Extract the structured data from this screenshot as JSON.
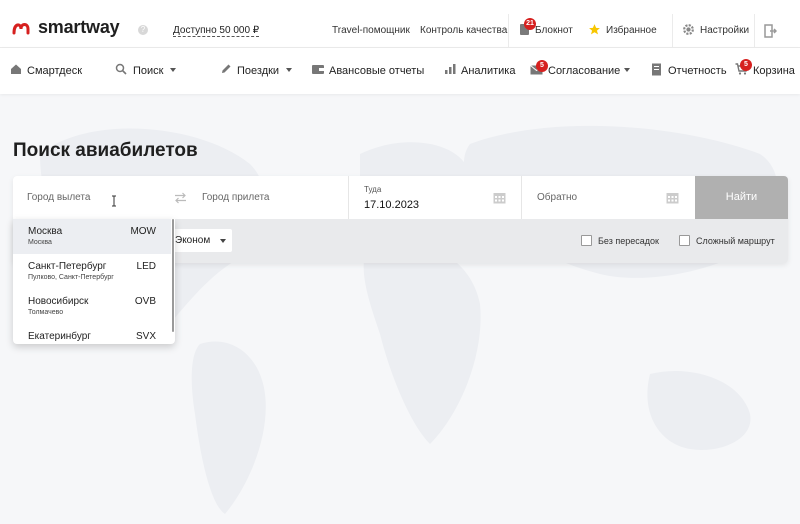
{
  "app": {
    "brand": "smartway",
    "help": "?",
    "balance": "Доступно 50 000 ₽",
    "colors": {
      "brand_red": "#d6201f",
      "accent_yellow": "#f7c600",
      "button_disabled": "#b0b0b0"
    }
  },
  "topbar": {
    "links": [
      {
        "label": "Travel-помощник"
      },
      {
        "label": "Контроль качества"
      },
      {
        "label": "Блокнот",
        "badge": "21",
        "icon": "notebook-icon"
      },
      {
        "label": "Избранное",
        "icon": "star-icon"
      },
      {
        "label": "Настройки",
        "icon": "gear-icon"
      }
    ],
    "logout_icon": "logout-icon"
  },
  "nav": {
    "items": [
      {
        "label": "Смартдеск",
        "icon": "home-icon"
      },
      {
        "label": "Поиск",
        "icon": "search-icon",
        "dropdown": true
      },
      {
        "label": "Поездки",
        "icon": "pencil-icon",
        "dropdown": true
      },
      {
        "label": "Авансовые отчеты",
        "icon": "wallet-icon"
      },
      {
        "label": "Аналитика",
        "icon": "chart-icon"
      },
      {
        "label": "Согласование",
        "icon": "envelope-icon",
        "badge": "5",
        "dropdown": true
      },
      {
        "label": "Отчетность",
        "icon": "document-icon"
      },
      {
        "label": "Корзина",
        "icon": "cart-icon",
        "badge": "5"
      }
    ]
  },
  "page": {
    "title": "Поиск авиабилетов"
  },
  "search": {
    "from_placeholder": "Город вылета",
    "to_placeholder": "Город прилета",
    "depart_label": "Туда",
    "depart_value": "17.10.2023",
    "return_placeholder": "Обратно",
    "find_label": "Найти",
    "class_value": "Эконом",
    "direct_label": "Без пересадок",
    "complex_label": "Сложный маршрут"
  },
  "dropdown": {
    "items": [
      {
        "city": "Москва",
        "sub": "Москва",
        "code": "MOW",
        "selected": true
      },
      {
        "city": "Санкт-Петербург",
        "sub": "Пулково, Санкт-Петербург",
        "code": "LED"
      },
      {
        "city": "Новосибирск",
        "sub": "Толмачево",
        "code": "OVB"
      },
      {
        "city": "Екатеринбург",
        "sub": "",
        "code": "SVX"
      }
    ]
  }
}
